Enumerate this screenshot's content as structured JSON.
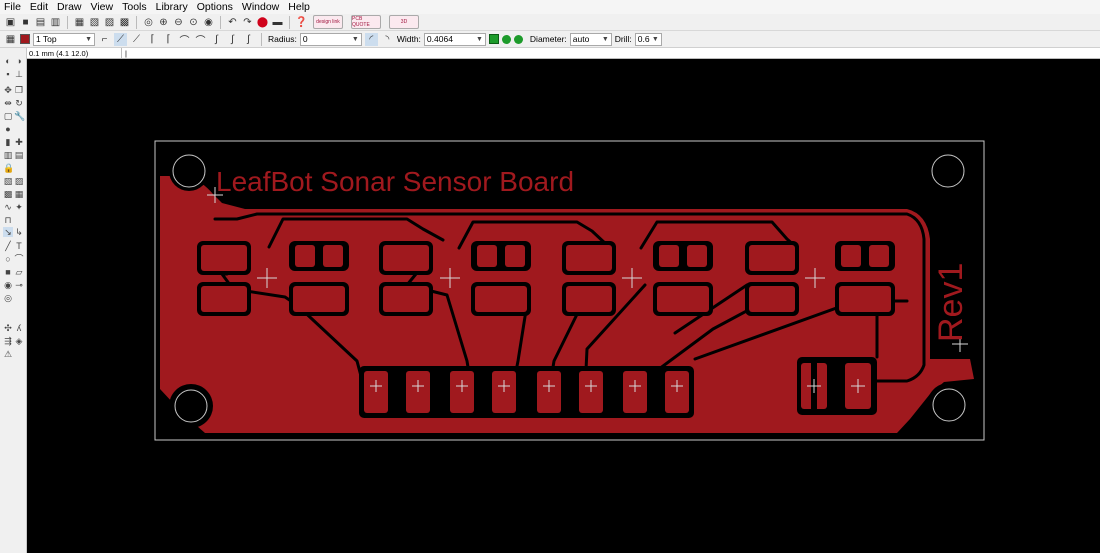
{
  "menubar": {
    "items": [
      "File",
      "Edit",
      "Draw",
      "View",
      "Tools",
      "Library",
      "Options",
      "Window",
      "Help"
    ]
  },
  "toolbar": {
    "promo_design": "design link",
    "promo_pcb": "PCB QUOTE",
    "promo_3d": "3D"
  },
  "params": {
    "layer": "1 Top",
    "radius_label": "Radius:",
    "radius_value": "0",
    "width_label": "Width:",
    "width_value": "0.4064",
    "diameter_label": "Diameter:",
    "diameter_value": "auto",
    "drill_label": "Drill:",
    "drill_value": "0.6"
  },
  "status": {
    "coordinates": "0.1 mm (4.1 12.0)",
    "command": "|"
  },
  "board": {
    "title": "LeafBot Sonar Sensor Board",
    "revision": "Rev1"
  },
  "colors": {
    "copper": "#a0191e",
    "background": "#000000",
    "outline": "#c8c8c8"
  }
}
